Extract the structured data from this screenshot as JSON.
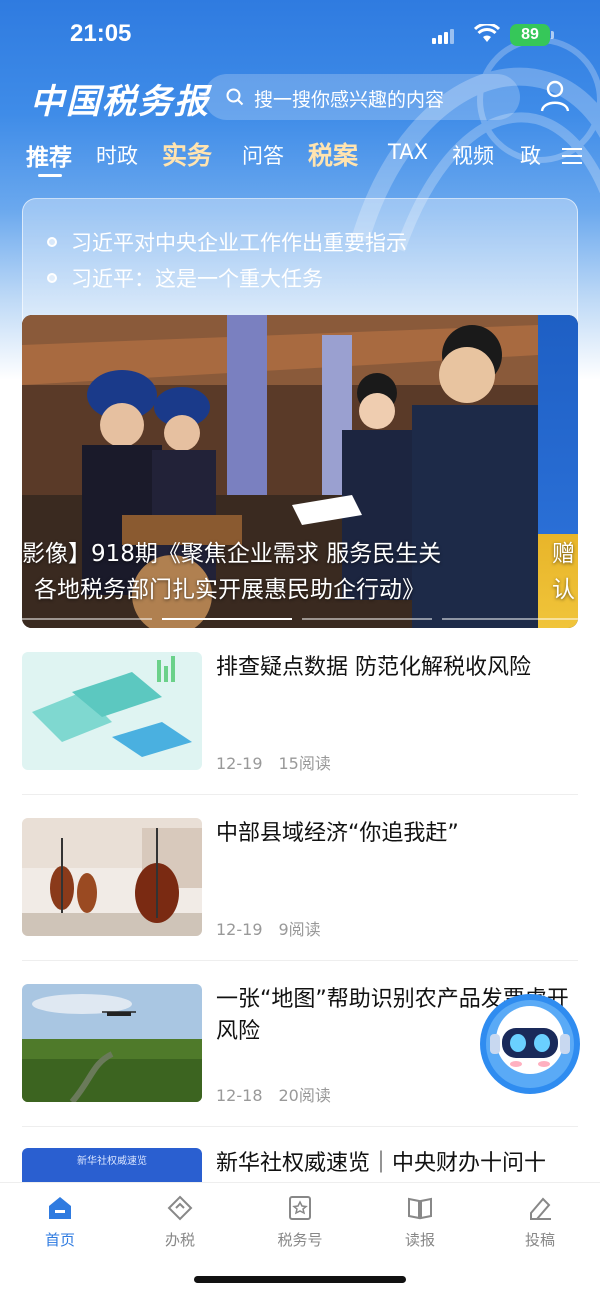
{
  "status": {
    "time": "21:05",
    "battery": "89"
  },
  "header": {
    "logo": "中国税务报",
    "search_placeholder": "搜一搜你感兴趣的内容"
  },
  "tabs": [
    {
      "label": "推荐",
      "active": true
    },
    {
      "label": "时政"
    },
    {
      "label": "实务",
      "style": "special"
    },
    {
      "label": "问答"
    },
    {
      "label": "税案",
      "style": "special"
    },
    {
      "label": "TAX"
    },
    {
      "label": "视频"
    },
    {
      "label": "政"
    }
  ],
  "headlines": [
    "习近平对中央企业工作作出重要指示",
    "习近平：这是一个重大任务"
  ],
  "banner": {
    "caption_line1": "影像】918期《聚焦企业需求 服务民生关",
    "caption_line2": "各地税务部门扎实开展惠民助企行动》",
    "next_caption_1": "赠",
    "next_caption_2": "认"
  },
  "news": [
    {
      "title": "排查疑点数据 防范化解税收风险",
      "date": "12-19",
      "reads": "15阅读"
    },
    {
      "title": " 中部县域经济“你追我赶”",
      "date": "12-19",
      "reads": "9阅读"
    },
    {
      "title": "一张“地图”帮助识别农产品发票虚开风险",
      "date": "12-18",
      "reads": "20阅读"
    },
    {
      "title": "新华社权威速览｜中央财办十问十",
      "thumb_label": "新华社权威速览"
    }
  ],
  "bottom_nav": [
    {
      "label": "首页",
      "icon": "home-icon",
      "active": true
    },
    {
      "label": "办税",
      "icon": "tax-service-icon"
    },
    {
      "label": "税务号",
      "icon": "star-badge-icon"
    },
    {
      "label": "读报",
      "icon": "book-icon"
    },
    {
      "label": "投稿",
      "icon": "edit-icon"
    }
  ],
  "colors": {
    "primary": "#2f7be0",
    "special_tab": "#ffe4b0"
  }
}
